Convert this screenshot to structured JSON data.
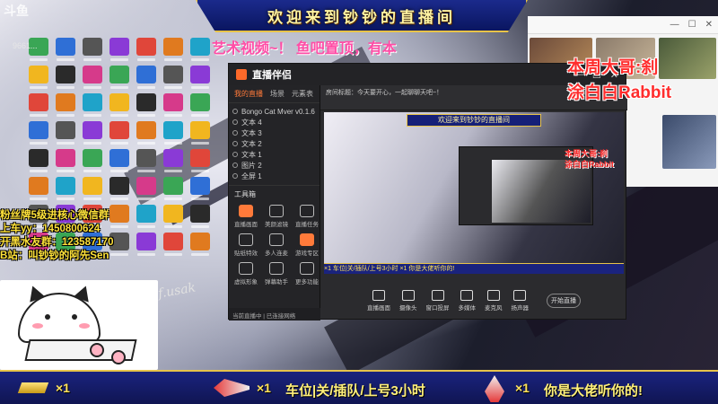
{
  "overlay": {
    "site_logo": "斗鱼",
    "room_id": "9661...",
    "top_banner": "欢迎来到钞钞的直播间",
    "marquee": "艺术视频~！ 鱼吧置顶，有本",
    "streamer_line1": "本周大哥:刹",
    "streamer_line2": "涂白白Rabbit",
    "promo_lines": [
      "粉丝牌5级进核心微信群",
      "上车yy：1450800624",
      "开黑水友群：123587170",
      "B站：叫钞钞的阿先Sen"
    ],
    "watermark": "f.usak",
    "bottom_items": [
      {
        "count": "×1",
        "text": ""
      },
      {
        "count": "×1",
        "text": "车位|关/插队/上号3小时"
      },
      {
        "count": "×1",
        "text": "你是大佬听你的!"
      }
    ]
  },
  "obs": {
    "app_title": "直播伴侣",
    "window_buttons": [
      "—",
      "☐",
      "✕"
    ],
    "side_tabs": [
      "我的直播",
      "场景",
      "元素表"
    ],
    "sources": [
      "Bongo Cat Mver v0.1.6",
      "文本 4",
      "文本 3",
      "文本 2",
      "文本 1",
      "图片 2",
      "全屏 1"
    ],
    "tools_title": "工具箱",
    "tools": [
      {
        "label": "直播画面",
        "orange": true
      },
      {
        "label": "美颜滤镜",
        "orange": false
      },
      {
        "label": "直播任务",
        "orange": false
      },
      {
        "label": "贴纸特效",
        "orange": false
      },
      {
        "label": "多人连麦",
        "orange": false
      },
      {
        "label": "游戏专区",
        "orange": true
      },
      {
        "label": "虚拟形象",
        "orange": false
      },
      {
        "label": "弹幕助手",
        "orange": false
      },
      {
        "label": "更多功能",
        "orange": false
      }
    ],
    "footer": "当前直播中 | 已连接网络",
    "toolbar_text": "房间标题：今天要开心，一起聊聊天吧~！",
    "nested_banner": "欢迎来到钞钞的直播间",
    "nested_label": "本周大哥:刹\n涂白白Rabbit",
    "nested_bottom": "×1  车位|关/插队/上号3小时      ×1  你是大佬听你的!",
    "controls": [
      "直播画面",
      "摄像头",
      "窗口投屏",
      "多媒体",
      "麦克风",
      "扬声器"
    ],
    "live_button": "开始直播"
  },
  "browser": {
    "bar_icons": [
      "—",
      "☐",
      "✕"
    ]
  }
}
